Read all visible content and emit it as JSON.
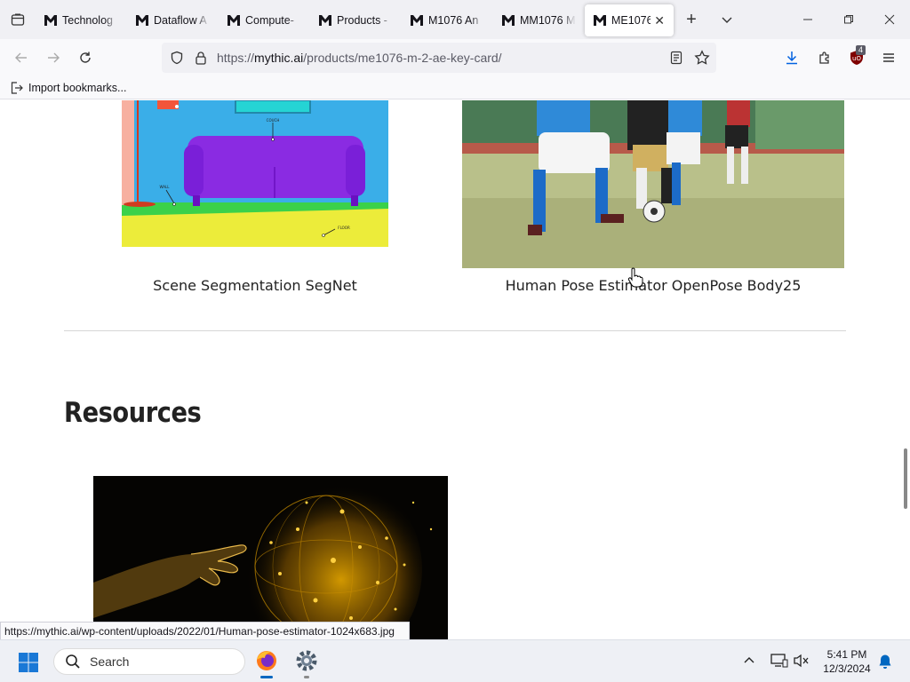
{
  "browser": {
    "tabs": [
      {
        "label": "Technolog",
        "active": false
      },
      {
        "label": "Dataflow A",
        "active": false
      },
      {
        "label": "Compute-",
        "active": false
      },
      {
        "label": "Products -",
        "active": false
      },
      {
        "label": "M1076 An",
        "active": false
      },
      {
        "label": "MM1076 M",
        "active": false
      },
      {
        "label": "ME1076",
        "active": true
      }
    ],
    "url_prefix": "https://",
    "url_domain": "mythic.ai",
    "url_path": "/products/me1076-m-2-ae-key-card/",
    "bookmark_label": "Import bookmarks...",
    "extension_badge": "4",
    "status_url": "https://mythic.ai/wp-content/uploads/2022/01/Human-pose-estimator-1024x683.jpg"
  },
  "page": {
    "cards": [
      {
        "caption": "Scene Segmentation SegNet"
      },
      {
        "caption": "Human Pose Estimator OpenPose Body25"
      }
    ],
    "segnet_labels": {
      "couch": "COUCH",
      "wall": "WALL",
      "floor": "FLOOR"
    },
    "resources_heading": "Resources"
  },
  "taskbar": {
    "search_placeholder": "Search",
    "time": "5:41 PM",
    "date": "12/3/2024"
  },
  "colors": {
    "tabbar_bg": "#f0f0f4",
    "navbar_bg": "#f9f9fb",
    "accent_blue": "#0061e0",
    "ublock_red": "#800000",
    "taskbar_bg": "#eef0f5"
  }
}
